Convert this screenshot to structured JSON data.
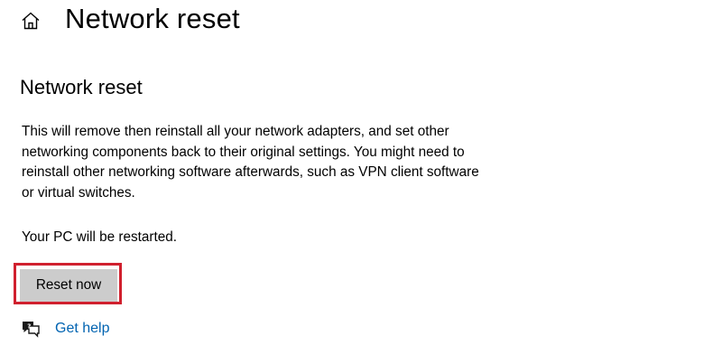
{
  "header": {
    "home_icon": "home-icon",
    "title": "Network reset"
  },
  "section": {
    "title": "Network reset",
    "description": "This will remove then reinstall all your network adapters, and set other networking components back to their original settings. You might need to reinstall other networking software afterwards, such as VPN client software or virtual switches.",
    "restart_note": "Your PC will be restarted."
  },
  "actions": {
    "reset_label": "Reset now",
    "help_icon": "chat-help-icon",
    "help_label": "Get help"
  },
  "colors": {
    "link": "#0063b1",
    "button_bg": "#cccccc",
    "highlight": "#d0202e"
  }
}
